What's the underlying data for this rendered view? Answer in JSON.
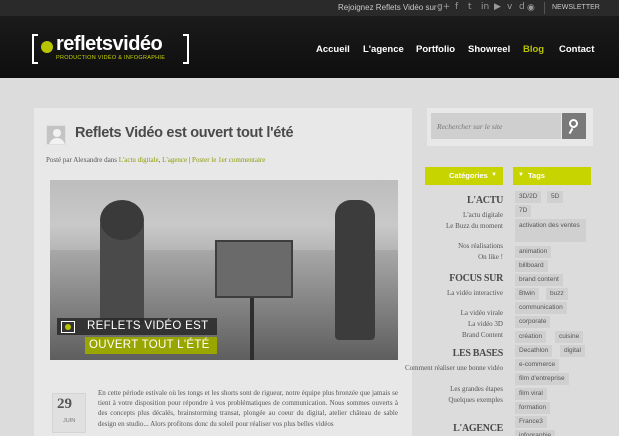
{
  "topbar": {
    "join_text": "Rejoignez Reflets Vidéo sur :",
    "social_icons": [
      "google-plus-icon",
      "facebook-icon",
      "twitter-icon",
      "linkedin-icon",
      "youtube-icon",
      "vimeo-icon",
      "dailymotion-icon",
      "rss-icon"
    ],
    "social_glyphs": [
      "g+",
      "f",
      "t",
      "in",
      "▶",
      "v",
      "d",
      "◉"
    ],
    "newsletter": "NEWSLETTER"
  },
  "header": {
    "logo_name": "refletsvidéo",
    "logo_tagline": "PRODUCTION VIDÉO & INFOGRAPHIE",
    "nav": [
      "Accueil",
      "L'agence",
      "Portfolio",
      "Showreel",
      "Blog",
      "Contact"
    ],
    "active_nav": "Blog",
    "accent_color": "#b8c400"
  },
  "post": {
    "title": "Reflets Vidéo est ouvert tout l'été",
    "meta_prefix": "Posté par Alexandre dans",
    "meta_cat1": "L'actu digitale",
    "meta_cat2": "L'agence",
    "meta_sep": "|",
    "meta_comment": "Poster le 1er commentaire",
    "overlay_line1": "REFLETS VIDÉO EST",
    "overlay_line2": "OUVERT TOUT L'ÉTÉ",
    "date_day": "29",
    "date_month": "JUIN",
    "excerpt": "En cette période estivale où les tongs et les shorts sont de rigueur, notre équipe plus bronzée que jamais se tient à votre disposition pour répondre à vos problématiques de communication. Nous sommes ouverts à des concepts plus décalés, brainstorming transat, plongée au coeur du digital, atelier château de sable design en studio... Alors profitons donc du soleil pour réaliser vos plus belles vidéos"
  },
  "search": {
    "placeholder": "Rechercher sur le site"
  },
  "categories": {
    "title": "Catégories",
    "groups": [
      {
        "name": "L'ACTU",
        "items": [
          "L'actu digitale",
          "Le Buzz du moment",
          "Nos réalisations",
          "On like !"
        ]
      },
      {
        "name": "FOCUS SUR",
        "items": [
          "La vidéo interactive",
          "La vidéo virale",
          "La vidéo 3D",
          "Brand Content"
        ]
      },
      {
        "name": "LES BASES",
        "items": [
          "Comment réaliser une bonne vidéo",
          "Les grandes étapes",
          "Quelques exemples"
        ]
      },
      {
        "name": "L'AGENCE",
        "items": []
      }
    ]
  },
  "tags": {
    "title": "Tags",
    "items": [
      "3D/2D",
      "5D",
      "7D",
      "activation des ventes",
      "animation",
      "billboard",
      "brand content",
      "Btwin",
      "buzz",
      "communication",
      "corporate",
      "création",
      "cuisine",
      "Decathlon",
      "digital",
      "e-commerce",
      "film d'entreprise",
      "film viral",
      "formation",
      "France3",
      "infographie"
    ]
  }
}
